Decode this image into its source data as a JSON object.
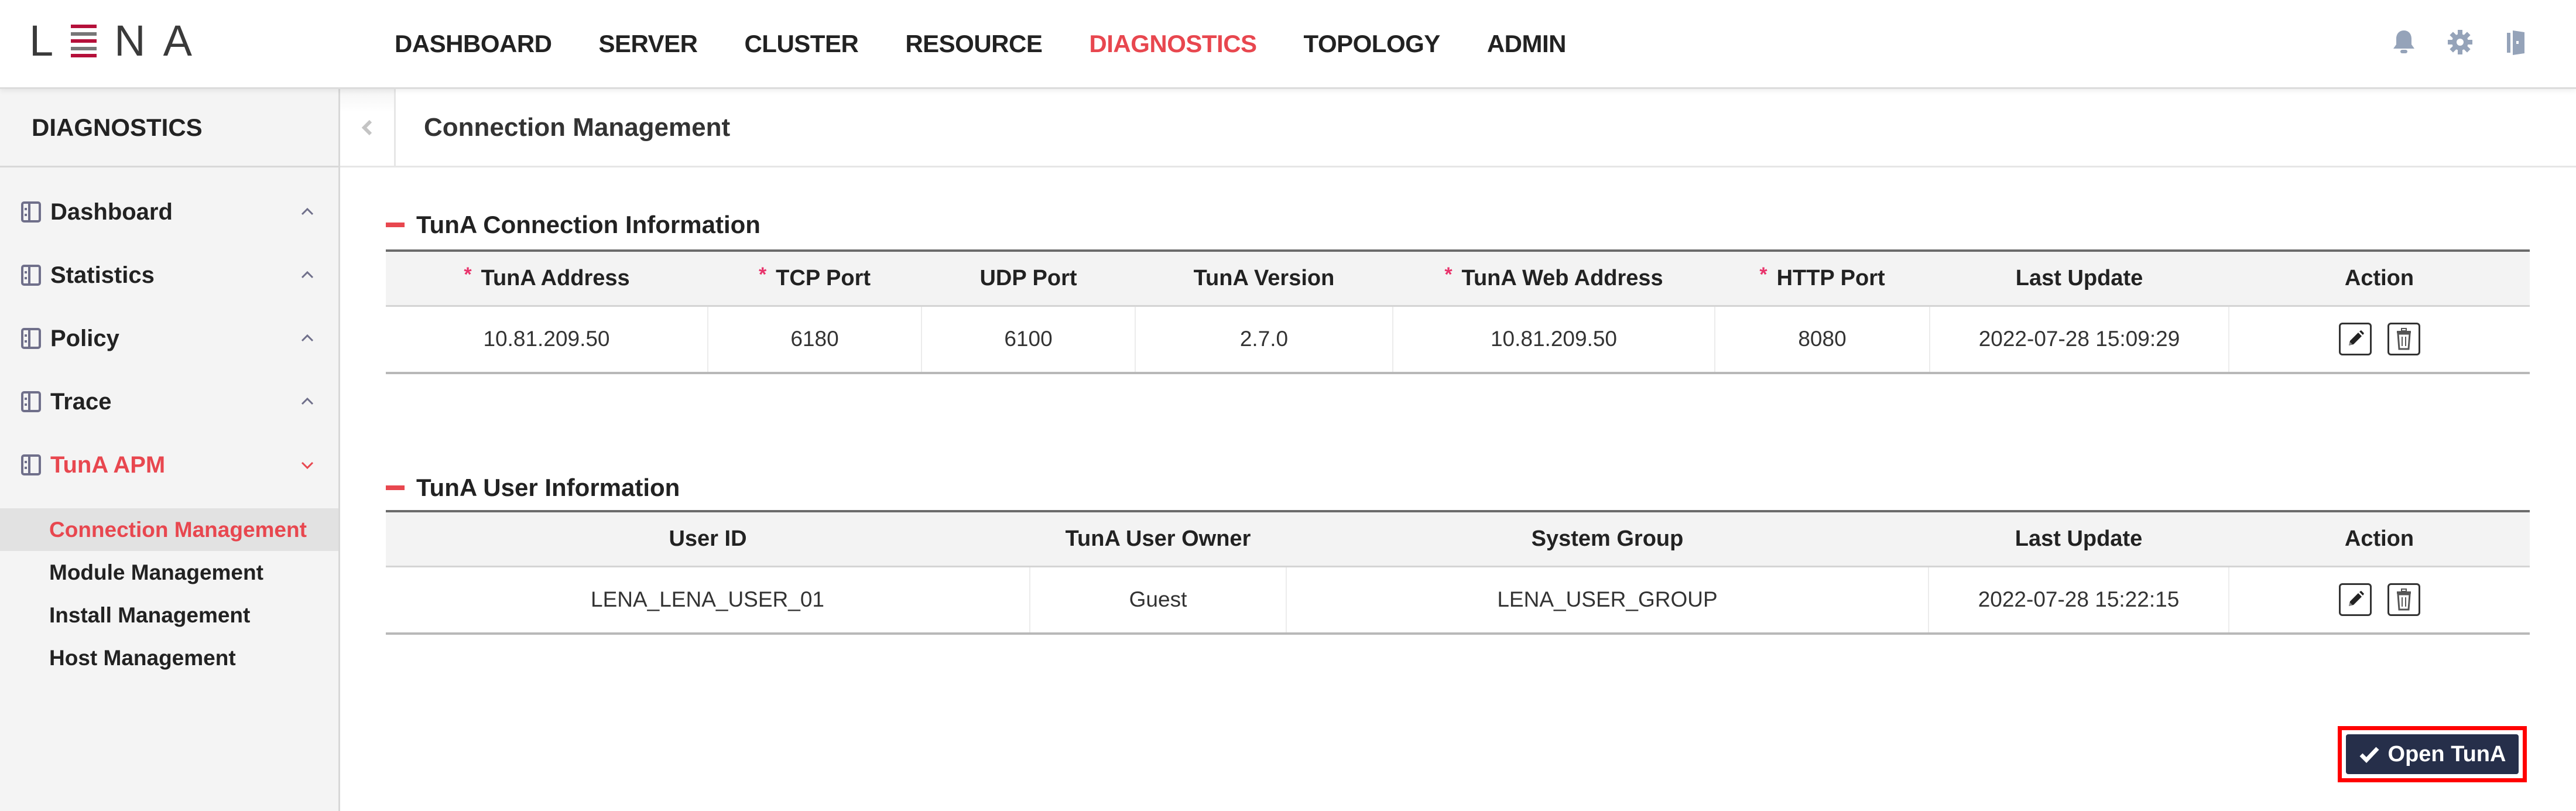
{
  "logo": {
    "letters": [
      "L",
      "N",
      "A"
    ],
    "icon": "lena-e-bars-logo",
    "bar_colors": [
      "#b5103a",
      "#777777",
      "#b5103a",
      "#777777",
      "#b5103a"
    ]
  },
  "topnav": {
    "items": [
      {
        "label": "DASHBOARD"
      },
      {
        "label": "SERVER"
      },
      {
        "label": "CLUSTER"
      },
      {
        "label": "RESOURCE"
      },
      {
        "label": "DIAGNOSTICS",
        "active": true
      },
      {
        "label": "TOPOLOGY"
      },
      {
        "label": "ADMIN"
      }
    ],
    "icons": [
      "bell-icon",
      "gear-icon",
      "logout-door-icon"
    ],
    "active_color": "#e8474f",
    "icon_color": "#95a3b9"
  },
  "sidebar": {
    "title": "DIAGNOSTICS",
    "groups": [
      {
        "label": "Dashboard",
        "expanded": false
      },
      {
        "label": "Statistics",
        "expanded": false
      },
      {
        "label": "Policy",
        "expanded": false
      },
      {
        "label": "Trace",
        "expanded": false
      },
      {
        "label": "TunA APM",
        "expanded": true
      }
    ],
    "sub_items": [
      {
        "label": "Connection Management",
        "active": true
      },
      {
        "label": "Module Management"
      },
      {
        "label": "Install Management"
      },
      {
        "label": "Host Management"
      }
    ]
  },
  "page": {
    "title": "Connection Management"
  },
  "connection_section": {
    "title": "TunA Connection Information",
    "columns": [
      {
        "label": "TunA Address",
        "required": true
      },
      {
        "label": "TCP Port",
        "required": true
      },
      {
        "label": "UDP Port",
        "required": false
      },
      {
        "label": "TunA Version",
        "required": false
      },
      {
        "label": "TunA Web Address",
        "required": true
      },
      {
        "label": "HTTP Port",
        "required": true
      },
      {
        "label": "Last Update",
        "required": false
      },
      {
        "label": "Action",
        "required": false
      }
    ],
    "rows": [
      [
        "10.81.209.50",
        "6180",
        "6100",
        "2.7.0",
        "10.81.209.50",
        "8080",
        "2022-07-28 15:09:29"
      ]
    ]
  },
  "user_section": {
    "title": "TunA User Information",
    "columns": [
      {
        "label": "User ID"
      },
      {
        "label": "TunA User Owner"
      },
      {
        "label": "System Group"
      },
      {
        "label": "Last Update"
      },
      {
        "label": "Action"
      }
    ],
    "rows": [
      [
        "LENA_LENA_USER_01",
        "Guest",
        "LENA_USER_GROUP",
        "2022-07-28 15:22:15"
      ]
    ]
  },
  "actions": {
    "edit_icon": "pencil-icon",
    "delete_icon": "trash-icon"
  },
  "open_button": {
    "label": "Open TunA",
    "icon": "check-icon",
    "color": "#262f4a",
    "highlight": "#ff0000"
  }
}
